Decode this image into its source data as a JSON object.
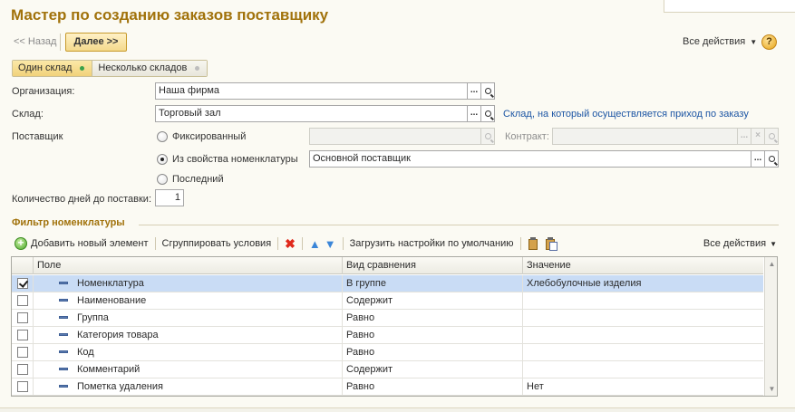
{
  "window": {
    "title": "Мастер по созданию заказов поставщику"
  },
  "nav": {
    "back_label": "<< Назад",
    "next_label": "Далее >>",
    "all_actions": "Все действия",
    "help": "?"
  },
  "mode": {
    "single": "Один склад",
    "multiple": "Несколько складов",
    "selected": "single"
  },
  "form": {
    "organization": {
      "label": "Организация:",
      "value": "Наша фирма"
    },
    "warehouse": {
      "label": "Склад:",
      "value": "Торговый зал",
      "hint": "Склад, на который осуществляется приход по заказу"
    },
    "supplier": {
      "label": "Поставщик",
      "options": [
        "Фиксированный",
        "Из свойства номенклатуры",
        "Последний"
      ],
      "selected_index": 1,
      "fixed_value": "",
      "contract_label": "Контракт:",
      "contract_value": "",
      "property_value": "Основной поставщик"
    },
    "delivery_days": {
      "label": "Количество дней до поставки:",
      "value": "1"
    }
  },
  "filter": {
    "title": "Фильтр номенклатуры",
    "toolbar": {
      "add": "Добавить новый элемент",
      "group": "Сгруппировать условия",
      "load_defaults": "Загрузить настройки по умолчанию",
      "all_actions": "Все действия"
    },
    "columns": [
      "Поле",
      "Вид сравнения",
      "Значение"
    ],
    "rows": [
      {
        "checked": true,
        "field": "Номенклатура",
        "comparison": "В группе",
        "value": "Хлебобулочные изделия",
        "selected": true
      },
      {
        "checked": false,
        "field": "Наименование",
        "comparison": "Содержит",
        "value": ""
      },
      {
        "checked": false,
        "field": "Группа",
        "comparison": "Равно",
        "value": ""
      },
      {
        "checked": false,
        "field": "Категория товара",
        "comparison": "Равно",
        "value": ""
      },
      {
        "checked": false,
        "field": "Код",
        "comparison": "Равно",
        "value": ""
      },
      {
        "checked": false,
        "field": "Комментарий",
        "comparison": "Содержит",
        "value": ""
      },
      {
        "checked": false,
        "field": "Пометка удаления",
        "comparison": "Равно",
        "value": "Нет"
      }
    ]
  }
}
